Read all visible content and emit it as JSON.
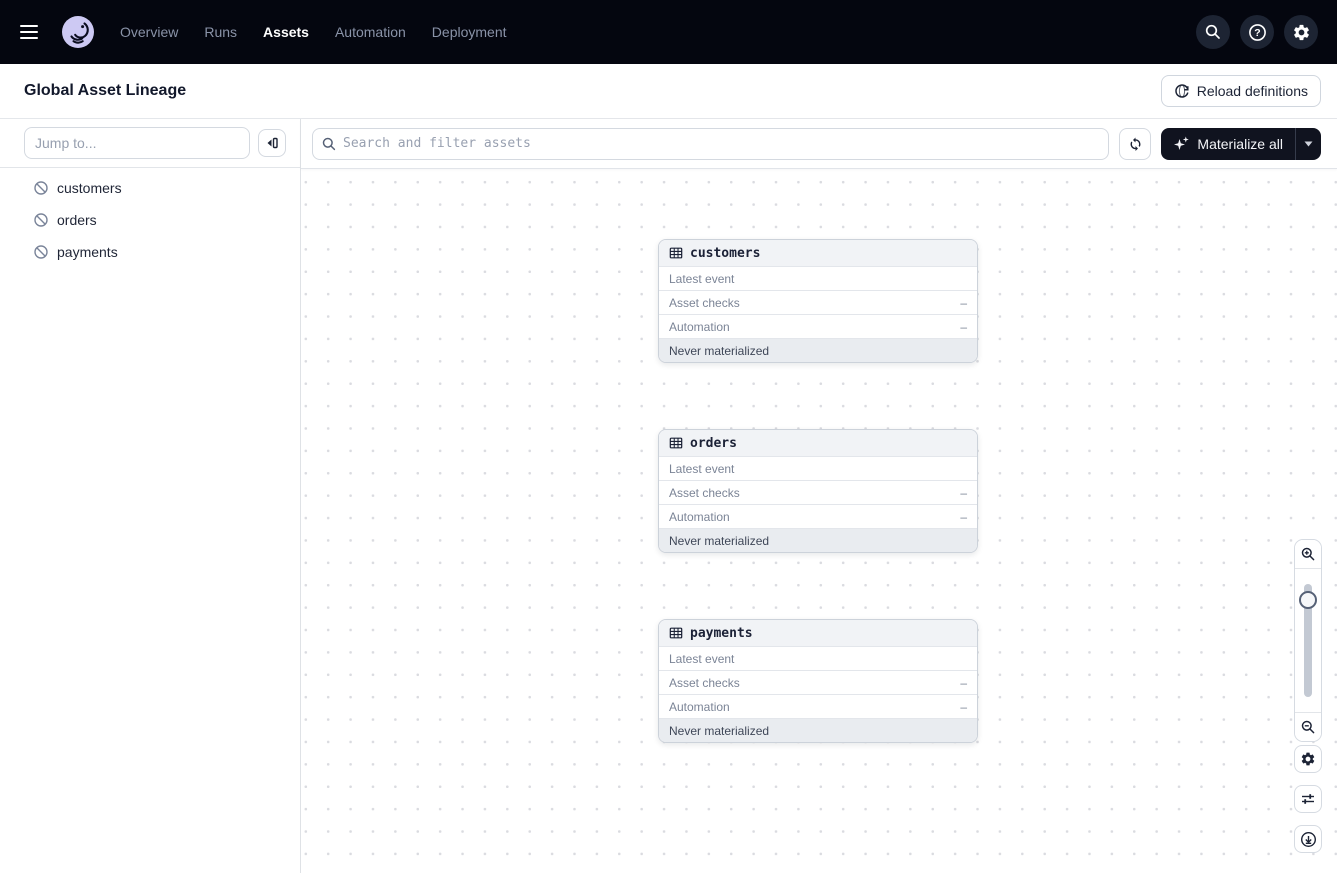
{
  "colors": {
    "nav_bg": "#04060f",
    "nav_icon_circle": "#1d2433",
    "accent_dark_button": "#10131f",
    "logo_lavender": "#cdc9f3",
    "node_header_bg": "#f1f3f6",
    "node_footer_bg": "#e9ecf0",
    "border": "#d6dbe2",
    "muted_text": "#7b8496",
    "dot_grid": "#dadbe0"
  },
  "nav": {
    "tabs": [
      {
        "label": "Overview",
        "active": false
      },
      {
        "label": "Runs",
        "active": false
      },
      {
        "label": "Assets",
        "active": true
      },
      {
        "label": "Automation",
        "active": false
      },
      {
        "label": "Deployment",
        "active": false
      }
    ],
    "icons": [
      "search-icon",
      "help-icon",
      "gear-icon"
    ]
  },
  "header": {
    "title": "Global Asset Lineage",
    "reload_label": "Reload definitions"
  },
  "sidebar": {
    "jump_placeholder": "Jump to...",
    "assets": [
      {
        "name": "customers"
      },
      {
        "name": "orders"
      },
      {
        "name": "payments"
      }
    ]
  },
  "toolbar": {
    "search_placeholder": "Search and filter assets",
    "materialize_label": "Materialize all"
  },
  "graph": {
    "nodes": [
      {
        "name": "customers",
        "rows": [
          {
            "label": "Latest event",
            "value": ""
          },
          {
            "label": "Asset checks",
            "value": "–"
          },
          {
            "label": "Automation",
            "value": "–"
          }
        ],
        "status": "Never materialized"
      },
      {
        "name": "orders",
        "rows": [
          {
            "label": "Latest event",
            "value": ""
          },
          {
            "label": "Asset checks",
            "value": "–"
          },
          {
            "label": "Automation",
            "value": "–"
          }
        ],
        "status": "Never materialized"
      },
      {
        "name": "payments",
        "rows": [
          {
            "label": "Latest event",
            "value": ""
          },
          {
            "label": "Asset checks",
            "value": "–"
          },
          {
            "label": "Automation",
            "value": "–"
          }
        ],
        "status": "Never materialized"
      }
    ]
  }
}
